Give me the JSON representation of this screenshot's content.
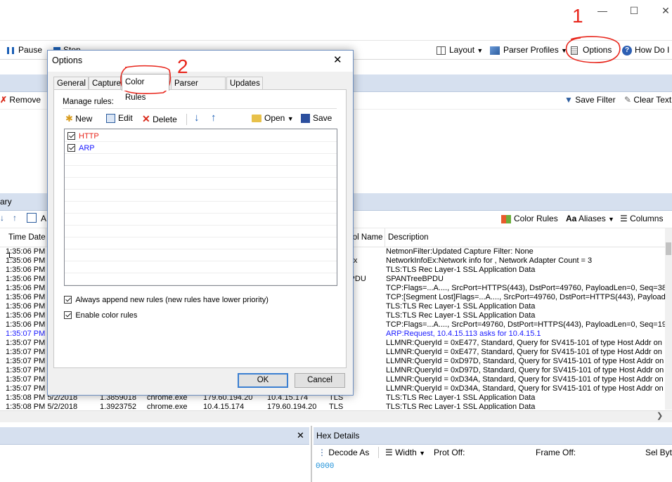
{
  "toolbar": {
    "pause": "Pause",
    "stop": "Stop",
    "layout": "Layout",
    "parser_profiles": "Parser Profiles",
    "options": "Options",
    "how_do_i": "How Do I"
  },
  "filter_toolbar": {
    "remove": "Remove",
    "save_filter": "Save Filter",
    "clear_text": "Clear Text"
  },
  "frame_summary": {
    "header_fragment": "ary",
    "toolbar_fragment": "A",
    "color_rules": "Color Rules",
    "aliases": "Aliases",
    "columns": "Columns",
    "col_time": "Time Date L",
    "col_protocol": "col Name",
    "col_description": "Description",
    "rows": [
      {
        "time": "1:35:06 PM",
        "proto": "nFilter",
        "desc": "NetmonFilter:Updated Capture Filter: None"
      },
      {
        "time": "1:35:06 PM",
        "proto": "rkInfoEx",
        "desc": "NetworkInfoEx:Network info for , Network Adapter Count = 3"
      },
      {
        "time": "1:35:06 PM",
        "proto": "",
        "desc": "TLS:TLS Rec Layer-1 SSL Application Data"
      },
      {
        "time": "1:35:06 PM",
        "proto": "TreeBPDU",
        "desc": "SPANTreeBPDU"
      },
      {
        "time": "1:35:06 PM",
        "proto": "",
        "desc": "TCP:Flags=...A...., SrcPort=HTTPS(443), DstPort=49760, PayloadLen=0, Seq=38"
      },
      {
        "time": "1:35:06 PM",
        "proto": "",
        "desc": "TCP:[Segment Lost]Flags=...A...., SrcPort=49760, DstPort=HTTPS(443), Payload"
      },
      {
        "time": "1:35:06 PM",
        "proto": "",
        "desc": "TLS:TLS Rec Layer-1 SSL Application Data"
      },
      {
        "time": "1:35:06 PM",
        "proto": "",
        "desc": "TLS:TLS Rec Layer-1 SSL Application Data"
      },
      {
        "time": "1:35:06 PM",
        "proto": "",
        "desc": "TCP:Flags=...A...., SrcPort=49760, DstPort=HTTPS(443), PayloadLen=0, Seq=19"
      },
      {
        "time": "1:35:07 PM",
        "proto": "",
        "desc": "ARP:Request, 10.4.15.113 asks for 10.4.15.1",
        "blue": true
      },
      {
        "time": "1:35:07 PM",
        "proto": "",
        "desc": "LLMNR:QueryId = 0xE477, Standard, Query  for SV415-101 of type Host Addr on"
      },
      {
        "time": "1:35:07 PM",
        "proto": "",
        "desc": "LLMNR:QueryId = 0xE477, Standard, Query  for SV415-101 of type Host Addr on"
      },
      {
        "time": "1:35:07 PM",
        "proto": "",
        "desc": "LLMNR:QueryId = 0xD97D, Standard, Query  for SV415-101 of type Host Addr on"
      },
      {
        "time": "1:35:07 PM",
        "proto": "",
        "desc": "LLMNR:QueryId = 0xD97D, Standard, Query  for SV415-101 of type Host Addr on"
      },
      {
        "time": "1:35:07 PM",
        "proto": "",
        "desc": "LLMNR:QueryId = 0xD34A, Standard, Query  for SV415-101 of type Host Addr on"
      },
      {
        "time": "1:35:07 PM",
        "proto": "",
        "desc": "LLMNR:QueryId = 0xD34A, Standard, Query  for SV415-101 of type Host Addr on"
      },
      {
        "time": "1:35:08 PM 5/2/2018",
        "offset": "1.3859018",
        "process": "chrome.exe",
        "src": "179.60.194.20",
        "dst": "10.4.15.174",
        "proto": "TLS",
        "desc": "TLS:TLS Rec Layer-1 SSL Application Data"
      },
      {
        "time": "1:35:08 PM 5/2/2018",
        "offset": "1.3923752",
        "process": "chrome.exe",
        "src": "10.4.15.174",
        "dst": "179.60.194.20",
        "proto": "TLS",
        "desc": "TLS:TLS Rec Layer-1 SSL Application Data"
      }
    ]
  },
  "hex_details": {
    "title": "Hex Details",
    "decode_as": "Decode As",
    "width": "Width",
    "prot_off": "Prot Off:",
    "frame_off": "Frame Off:",
    "sel_bytes": "Sel Byte",
    "first_offset": "0000"
  },
  "dialog": {
    "title": "Options",
    "tabs": [
      "General",
      "Capture",
      "Color Rules",
      "Parser Profiles",
      "Updates"
    ],
    "selected_tab": "Color Rules",
    "manage_rules_label": "Manage rules:",
    "new": "New",
    "edit": "Edit",
    "delete": "Delete",
    "open": "Open",
    "save": "Save",
    "rules": [
      {
        "name": "HTTP",
        "checked": true,
        "color": "#e8261c"
      },
      {
        "name": "ARP",
        "checked": true,
        "color": "#1a1aff"
      }
    ],
    "always_append_label": "Always append new rules (new rules have lower priority)",
    "always_append_checked": true,
    "enable_color_rules_label": "Enable color rules",
    "enable_color_rules_checked": true,
    "ok": "OK",
    "cancel": "Cancel"
  },
  "annotations": {
    "step1": "1",
    "step2": "2",
    "mark_color": "#e8261c"
  }
}
